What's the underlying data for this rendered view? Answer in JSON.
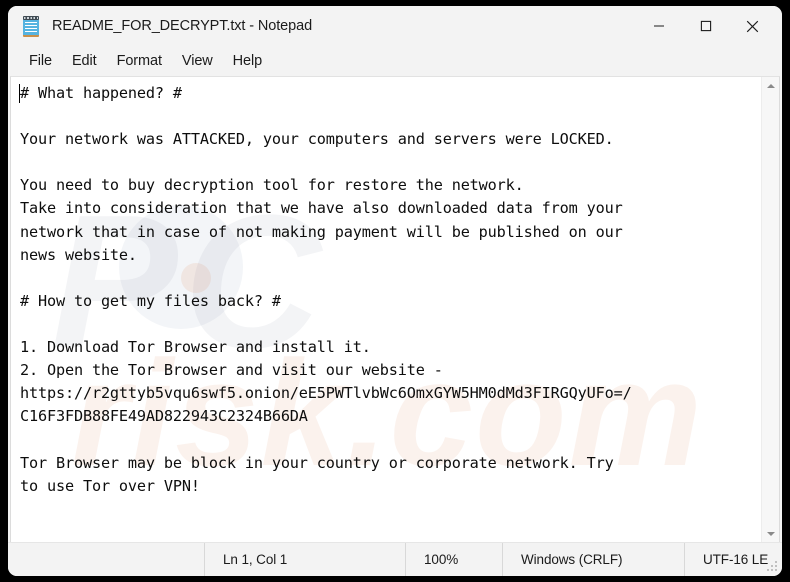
{
  "window": {
    "title": "README_FOR_DECRYPT.txt - Notepad",
    "icon": "notepad-icon",
    "controls": {
      "minimize": "minimize-icon",
      "maximize": "maximize-icon",
      "close": "close-icon"
    }
  },
  "menubar": {
    "items": [
      {
        "label": "File"
      },
      {
        "label": "Edit"
      },
      {
        "label": "Format"
      },
      {
        "label": "View"
      },
      {
        "label": "Help"
      }
    ]
  },
  "editor": {
    "content": "# What happened? #\n\nYour network was ATTACKED, your computers and servers were LOCKED.\n\nYou need to buy decryption tool for restore the network.\nTake into consideration that we have also downloaded data from your\nnetwork that in case of not making payment will be published on our\nnews website.\n\n# How to get my files back? #\n\n1. Download Tor Browser and install it.\n2. Open the Tor Browser and visit our website -\nhttps://r2gttyb5vqu6swf5.onion/eE5PWTlvbWc6OmxGYW5HM0dMd3FIRGQyUFo=/\nC16F3FDB88FE49AD822943C2324B66DA\n\nTor Browser may be block in your country or corporate network. Try\nto use Tor over VPN!",
    "lines": [
      "# What happened? #",
      "",
      "Your network was ATTACKED, your computers and servers were LOCKED.",
      "",
      "You need to buy decryption tool for restore the network.",
      "Take into consideration that we have also downloaded data from your",
      "network that in case of not making payment will be published on our",
      "news website.",
      "",
      "# How to get my files back? #",
      "",
      "1. Download Tor Browser and install it.",
      "2. Open the Tor Browser and visit our website -",
      "https://r2gttyb5vqu6swf5.onion/eE5PWTlvbWc6OmxGYW5HM0dMd3FIRGQyUFo=/",
      "C16F3FDB88FE49AD822943C2324B66DA",
      "",
      "Tor Browser may be block in your country or corporate network. Try",
      "to use Tor over VPN!"
    ],
    "onion_url": "https://r2gttyb5vqu6swf5.onion/eE5PWTlvbWc6OmxGYW5HM0dMd3FIRGQyUFo=/",
    "victim_id": "C16F3FDB88FE49AD822943C2324B66DA"
  },
  "scrollbar": {
    "up_arrow": "scroll-up-icon",
    "down_arrow": "scroll-down-icon"
  },
  "statusbar": {
    "position": "Ln 1, Col 1",
    "zoom": "100%",
    "line_ending": "Windows (CRLF)",
    "encoding": "UTF-16 LE"
  },
  "watermark": {
    "primary": "PC",
    "secondary": "risk.com"
  },
  "colors": {
    "window_chrome": "#f3f3f3",
    "editor_bg": "#ffffff",
    "text": "#0d0d0d",
    "desktop": "#000000",
    "icon_blue": "#55b3e0"
  }
}
